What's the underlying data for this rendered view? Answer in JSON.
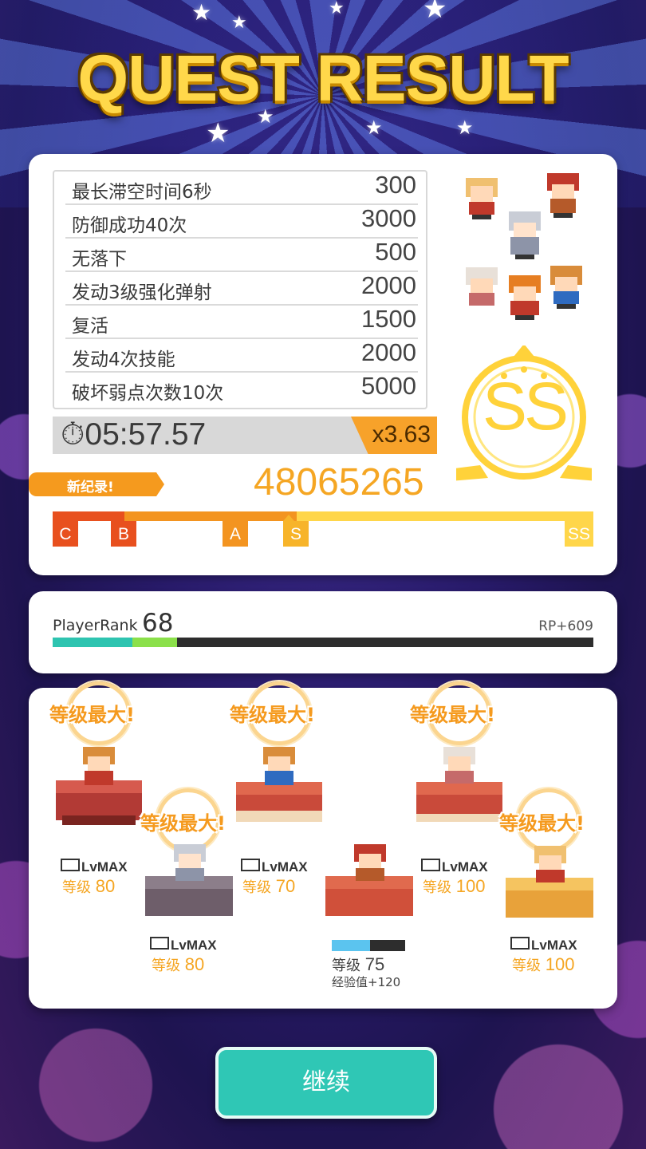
{
  "title": "QUEST RESULT",
  "missions": [
    {
      "label": "最长滞空时间6秒",
      "value": "300"
    },
    {
      "label": "防御成功40次",
      "value": "3000"
    },
    {
      "label": "无落下",
      "value": "500"
    },
    {
      "label": "发动3级强化弹射",
      "value": "2000"
    },
    {
      "label": "复活",
      "value": "1500"
    },
    {
      "label": "发动4次技能",
      "value": "2000"
    },
    {
      "label": "破坏弱点次数10次",
      "value": "5000"
    }
  ],
  "clear_time": "05:57.57",
  "multiplier": "x3.63",
  "new_record_label": "新纪录!",
  "score": "48065265",
  "grade": "SS",
  "rank_markers": [
    "C",
    "B",
    "A",
    "S",
    "SS"
  ],
  "player_rank": {
    "label": "PlayerRank",
    "value": "68",
    "rp": "RP+609"
  },
  "party": [
    {
      "max_label": "等级最大!",
      "lvmax": "LvMAX",
      "level_label": "等级",
      "level": "80"
    },
    {
      "max_label": "等级最大!",
      "lvmax": "LvMAX",
      "level_label": "等级",
      "level": "80"
    },
    {
      "max_label": "等级最大!",
      "lvmax": "LvMAX",
      "level_label": "等级",
      "level": "70"
    },
    {
      "level_label": "等级",
      "level": "75",
      "exp": "经验值+120"
    },
    {
      "max_label": "等级最大!",
      "lvmax": "LvMAX",
      "level_label": "等级",
      "level": "100"
    },
    {
      "max_label": "等级最大!",
      "lvmax": "LvMAX",
      "level_label": "等级",
      "level": "100"
    }
  ],
  "continue_label": "继续",
  "colors": {
    "accent": "#f5a623",
    "button": "#2fc7b5",
    "grade": "#ffd23a"
  }
}
